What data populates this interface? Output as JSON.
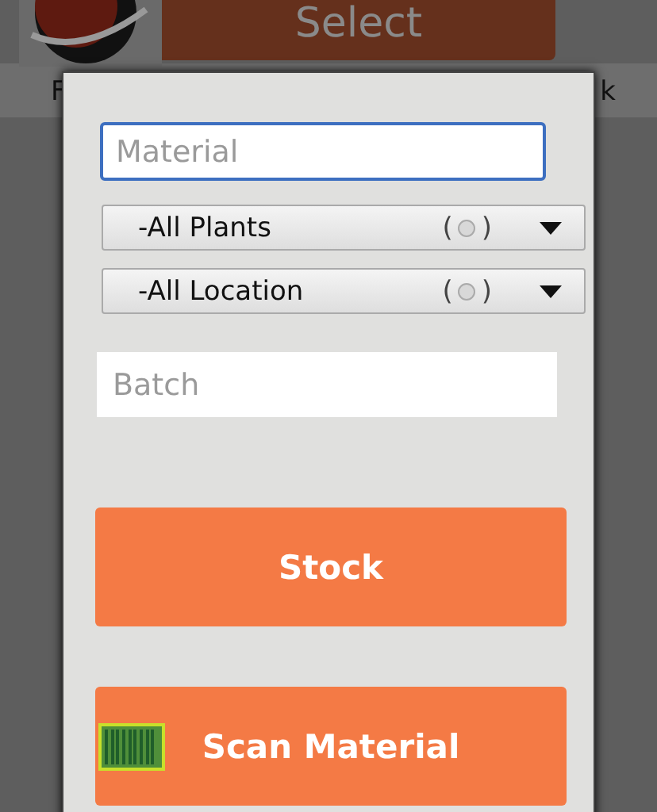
{
  "background": {
    "button": "Select",
    "left_text": "F",
    "right_text": "k"
  },
  "dialog": {
    "material": {
      "placeholder": "Material"
    },
    "dropdowns": [
      {
        "label": "-All Plants",
        "open_paren": "(",
        "close_paren": ")"
      },
      {
        "label": "-All Location",
        "open_paren": "(",
        "close_paren": ")"
      }
    ],
    "batch": {
      "placeholder": "Batch"
    },
    "buttons": [
      {
        "kind": "plain",
        "label": "Stock"
      },
      {
        "kind": "scan",
        "label": "Scan Material"
      }
    ]
  }
}
